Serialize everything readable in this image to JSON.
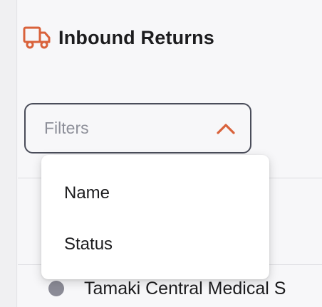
{
  "header": {
    "title": "Inbound Returns",
    "icon": "truck-icon",
    "accent_color": "#d9623b"
  },
  "filter": {
    "placeholder": "Filters",
    "expanded": true,
    "icon": "chevron-up-icon"
  },
  "dropdown": {
    "options": [
      {
        "label": "Name"
      },
      {
        "label": "Status"
      }
    ]
  },
  "list": {
    "rows": [
      {
        "label": "Tamaki Central Medical S",
        "status_color": "#8b8b96"
      }
    ]
  }
}
